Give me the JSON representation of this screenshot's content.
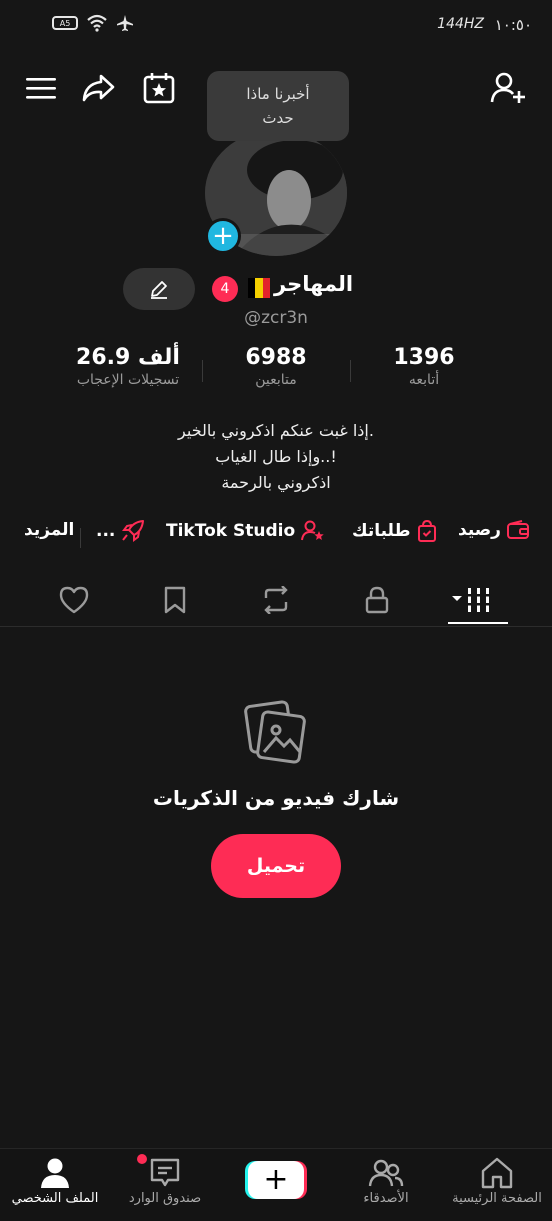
{
  "status_bar": {
    "time": "١٠:٥٠",
    "refresh": "144HZ",
    "battery": "A5"
  },
  "tooltip": {
    "line1": "أخبرنا ماذا",
    "line2": "حدث"
  },
  "profile": {
    "name": "المهاجر",
    "notification_count": "4",
    "handle": "@zcr3n",
    "flag_colors": [
      "#000000",
      "#f5d000",
      "#e3242b"
    ]
  },
  "stats": {
    "likes": {
      "value": "26.9 ألف",
      "label": "تسجيلات الإعجاب"
    },
    "followers": {
      "value": "6988",
      "label": "متابعين"
    },
    "following": {
      "value": "1396",
      "label": "أتابعه"
    }
  },
  "bio": {
    "line1": "إذا غبت عنكم اذكروني بالخير.",
    "line2": "وإذا طال الغياب..!",
    "line3": "اذكروني بالرحمة"
  },
  "links": {
    "balance": "رصيد",
    "orders": "طلباتك",
    "studio": "TikTok Studio",
    "ellipsis": "...",
    "more": "المزيد"
  },
  "empty_state": {
    "title": "شارك فيديو من الذكريات",
    "button": "تحميل"
  },
  "bottom_nav": {
    "home": "الصفحة الرئيسية",
    "friends": "الأصدقاء",
    "inbox": "صندوق الوارد",
    "profile": "الملف الشخصي"
  },
  "colors": {
    "accent": "#fe2c55",
    "cyan": "#25f4ee",
    "background": "#161616"
  }
}
